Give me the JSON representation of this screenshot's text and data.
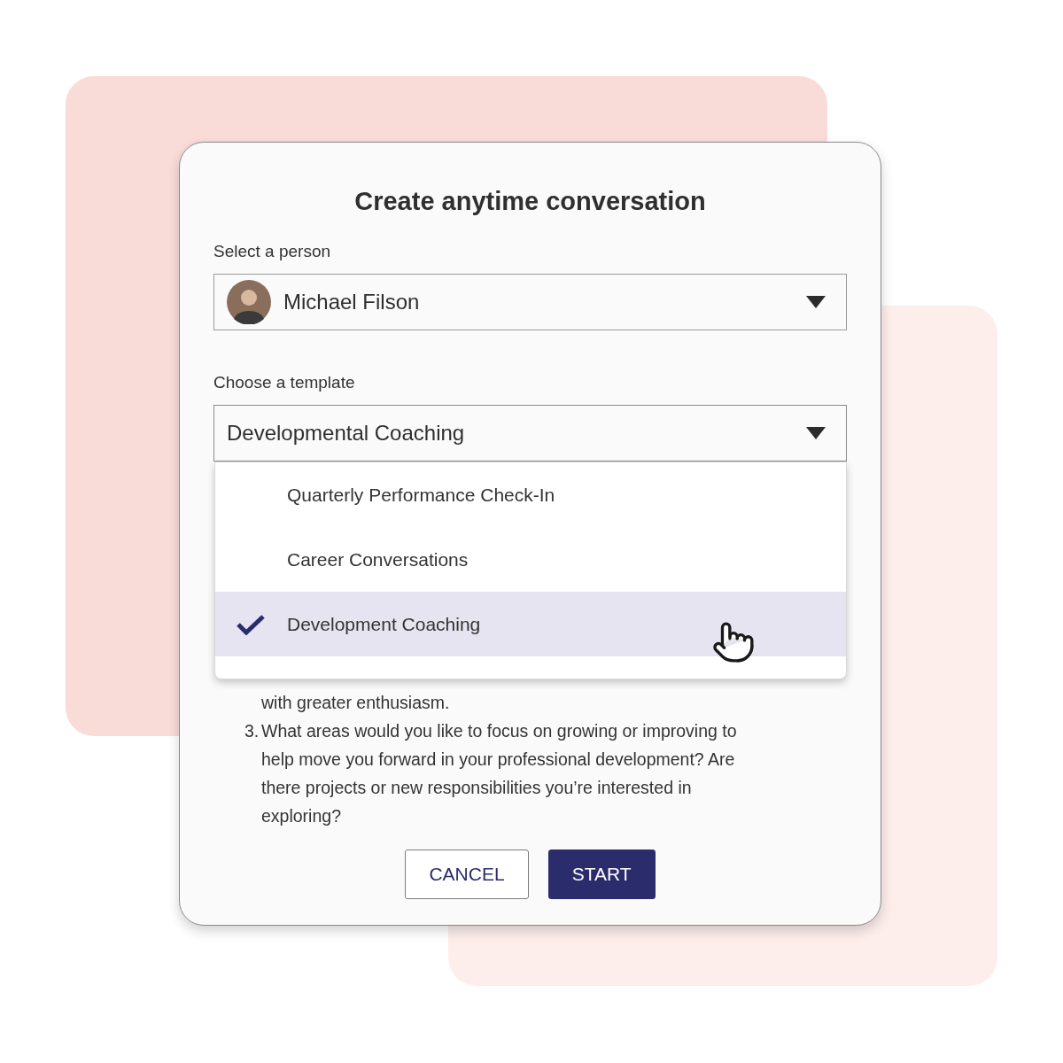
{
  "dialog": {
    "title": "Create anytime conversation"
  },
  "person_field": {
    "label": "Select a person",
    "value": "Michael Filson"
  },
  "template_field": {
    "label": "Choose a template",
    "value": "Developmental Coaching",
    "expanded": true
  },
  "template_options": [
    {
      "label": "Quarterly Performance Check-In",
      "selected": false
    },
    {
      "label": "Career Conversations",
      "selected": false
    },
    {
      "label": "Development Coaching",
      "selected": true
    }
  ],
  "questions": [
    {
      "text": "with greater enthusiasm."
    },
    {
      "number": "3.",
      "text": "What areas would you like to focus on growing or improving to help move you forward in your professional development? Are there projects or new responsibilities you’re interested in exploring?"
    }
  ],
  "buttons": [
    {
      "label": "CANCEL",
      "kind": "secondary"
    },
    {
      "label": "START",
      "kind": "primary"
    }
  ]
}
